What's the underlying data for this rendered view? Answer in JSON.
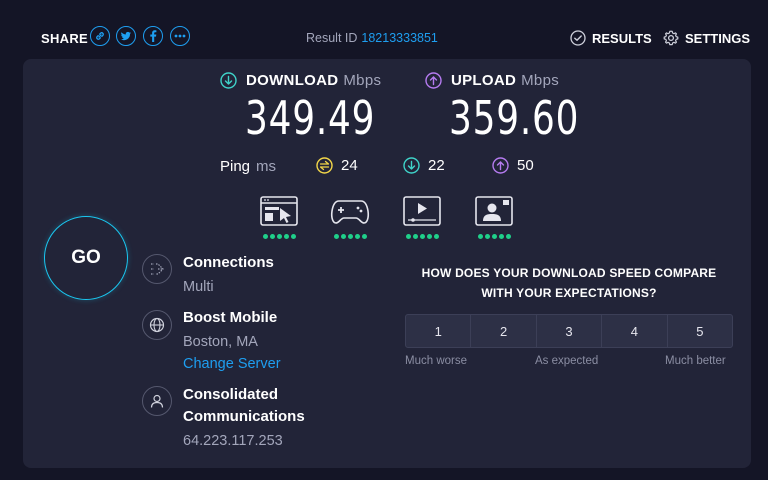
{
  "header": {
    "share_label": "SHARE",
    "share_icons": [
      "link-icon",
      "twitter-icon",
      "facebook-icon",
      "more-icon"
    ],
    "result_label": "Result ID",
    "result_id": "18213333851",
    "results_label": "RESULTS",
    "settings_label": "SETTINGS"
  },
  "download": {
    "label": "DOWNLOAD",
    "unit": "Mbps",
    "value": "349.49"
  },
  "upload": {
    "label": "UPLOAD",
    "unit": "Mbps",
    "value": "359.60"
  },
  "ping": {
    "label": "Ping",
    "unit": "ms",
    "idle": "24",
    "download": "22",
    "upload": "50"
  },
  "usecases": [
    {
      "icon": "web-browsing-icon",
      "rating": 5
    },
    {
      "icon": "gaming-icon",
      "rating": 5
    },
    {
      "icon": "video-streaming-icon",
      "rating": 5
    },
    {
      "icon": "video-call-icon",
      "rating": 5
    }
  ],
  "go_label": "GO",
  "connections": {
    "title": "Connections",
    "value": "Multi"
  },
  "server": {
    "title": "Boost Mobile",
    "location": "Boston, MA",
    "change_label": "Change Server"
  },
  "provider": {
    "title_line1": "Consolidated",
    "title_line2": "Communications",
    "ip": "64.223.117.253"
  },
  "survey": {
    "question_line1": "HOW DOES YOUR DOWNLOAD SPEED COMPARE",
    "question_line2": "WITH YOUR EXPECTATIONS?",
    "options": [
      "1",
      "2",
      "3",
      "4",
      "5"
    ],
    "low_label": "Much worse",
    "mid_label": "As expected",
    "high_label": "Much better"
  },
  "colors": {
    "background": "#141526",
    "panel": "#222438",
    "link": "#1e9ef0",
    "download_accent": "#3fd3c9",
    "upload_accent": "#b57bf0",
    "idle_accent": "#f2d649",
    "rating_dot": "#1fd08a",
    "go_ring": "#1ac7f0"
  }
}
